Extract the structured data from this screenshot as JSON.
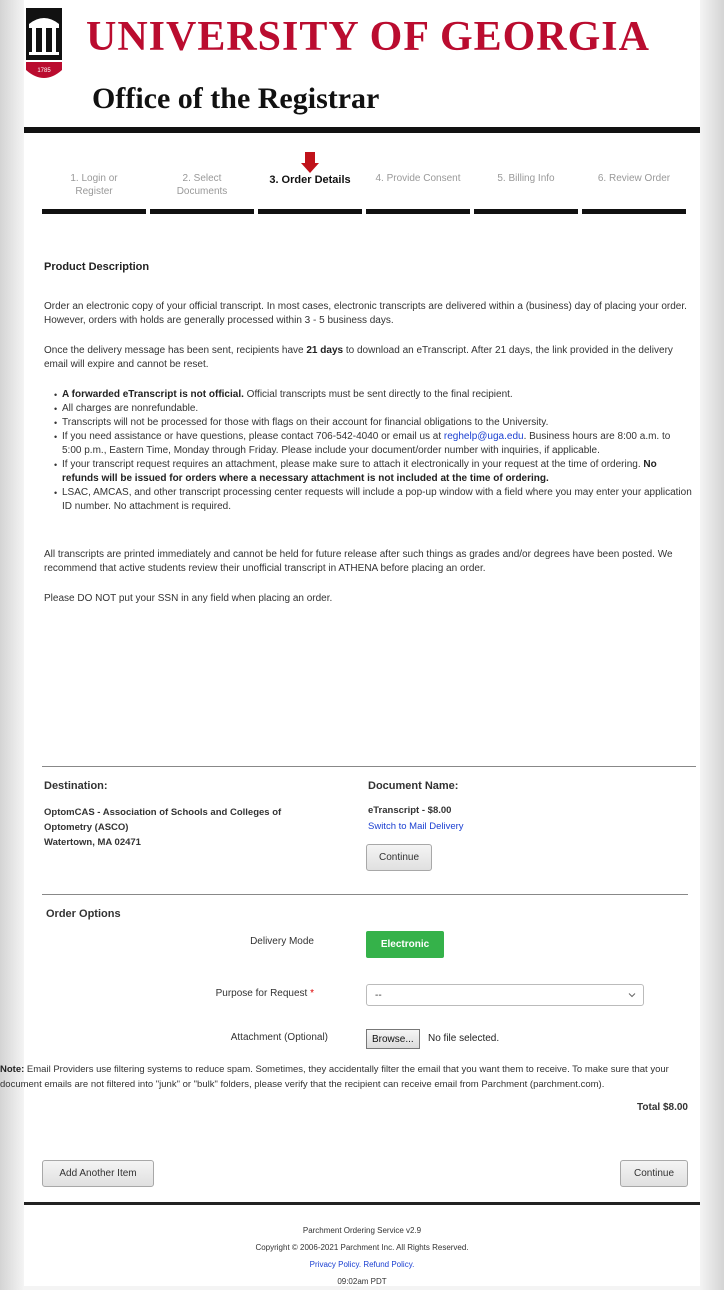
{
  "header": {
    "university": "UNIVERSITY OF GEORGIA",
    "office": "Office of the Registrar",
    "seal_year": "1785",
    "brand_color": "#ba0c2f"
  },
  "steps": [
    {
      "label_line1": "1. Login or",
      "label_line2": "Register",
      "active": false
    },
    {
      "label_line1": "2. Select",
      "label_line2": "Documents",
      "active": false
    },
    {
      "label_line1": "3. Order Details",
      "label_line2": "",
      "active": true
    },
    {
      "label_line1": "4. Provide Consent",
      "label_line2": "",
      "active": false
    },
    {
      "label_line1": "5. Billing Info",
      "label_line2": "",
      "active": false
    },
    {
      "label_line1": "6. Review Order",
      "label_line2": "",
      "active": false
    }
  ],
  "product": {
    "title": "Product Description",
    "para1": "Order an electronic copy of your official transcript. In most cases, electronic transcripts are delivered within a (business) day of placing your order. However, orders with holds are generally processed within 3 - 5 business days.",
    "para2_a": "Once the delivery message has been sent, recipients have ",
    "para2_bold": "21 days",
    "para2_b": " to download an eTranscript.  After 21 days, the link provided in the delivery email will expire and cannot be reset.",
    "bullet1_bold": "A forwarded eTranscript is not official.",
    "bullet1_rest": " Official transcripts must be sent directly to the final recipient.",
    "bullet2": "All charges are nonrefundable.",
    "bullet3": "Transcripts will not be processed for those with flags on their account for financial obligations to the University.",
    "bullet4_a": "If you need assistance or have questions, please contact 706-542-4040 or email us at ",
    "bullet4_email": "reghelp@uga.edu",
    "bullet4_b": ". Business hours are 8:00 a.m. to 5:00 p.m., Eastern Time, Monday through Friday. Please include your document/order number with inquiries, if applicable.",
    "bullet5_a": "If your transcript request requires an attachment, please make sure to attach it electronically in your request at the time of ordering.  ",
    "bullet5_bold": "No refunds will be issued for orders where a necessary attachment is not included at the time of ordering.",
    "bullet6": "LSAC,  AMCAS, and other transcript processing center requests will include a pop-up window with a field where you may enter your application ID number. No attachment is required.",
    "para3": "All transcripts are printed immediately and cannot be held for future release after such things as grades and/or degrees have been posted. We recommend that active students review their unofficial transcript in ATHENA before placing an order.",
    "para4": "Please DO NOT put your SSN in any field when placing an order."
  },
  "destination": {
    "heading": "Destination:",
    "line1": "OptomCAS - Association of Schools and Colleges of",
    "line2": "Optometry (ASCO)",
    "line3": "Watertown, MA 02471"
  },
  "document": {
    "heading": "Document Name:",
    "name": "eTranscript - $8.00",
    "switch_link": "Switch to Mail Delivery",
    "continue_label": "Continue"
  },
  "options": {
    "heading": "Order Options",
    "delivery_label": "Delivery Mode",
    "delivery_value": "Electronic",
    "delivery_color": "#35b24a",
    "purpose_label": "Purpose for Request",
    "purpose_required": "*",
    "purpose_value": "--",
    "attachment_label": "Attachment (Optional)",
    "browse_label": "Browse...",
    "no_file": "No file selected."
  },
  "note": {
    "bold": "Note:",
    "text": " Email Providers use filtering systems to reduce spam. Sometimes, they accidentally filter the email that you want them to receive. To make sure that your document emails are not filtered into \"junk\" or \"bulk\" folders, please verify that the recipient can receive email from Parchment (parchment.com)."
  },
  "total": "Total $8.00",
  "actions": {
    "add_item": "Add Another Item",
    "continue": "Continue"
  },
  "footer": {
    "service": "Parchment Ordering Service v2.9",
    "copyright": "Copyright © 2006-2021 Parchment Inc. All Rights Reserved.",
    "privacy": "Privacy Policy.",
    "refund": "Refund Policy.",
    "time": "09:02am PDT"
  }
}
